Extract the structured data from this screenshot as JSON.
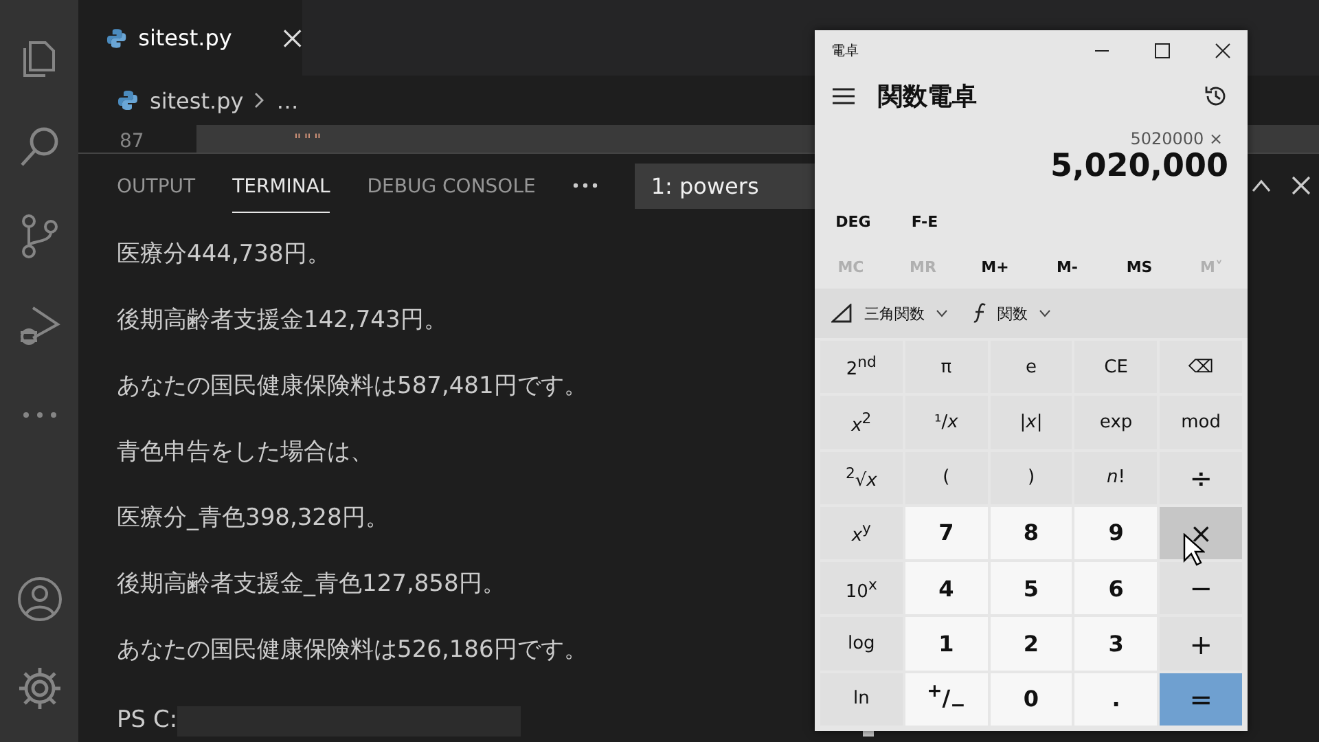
{
  "editor": {
    "tab": {
      "title": "sitest.py",
      "selected": true
    },
    "breadcrumb": {
      "file": "sitest.py",
      "rest": "…"
    },
    "code_line": {
      "number": "87",
      "text": "\"\"\""
    }
  },
  "panel": {
    "tabs": [
      {
        "label": "OUTPUT",
        "selected": false
      },
      {
        "label": "TERMINAL",
        "selected": true
      },
      {
        "label": "DEBUG CONSOLE",
        "selected": false
      }
    ],
    "terminal_selector": "1: powers",
    "terminal_lines": [
      "医療分444,738円。",
      "後期高齢者支援金142,743円。",
      "あなたの国民健康保険料は587,481円です。",
      "青色申告をした場合は、",
      "医療分_青色398,328円。",
      "後期高齢者支援金_青色127,858円。",
      "あなたの国民健康保険料は526,186円です。"
    ],
    "prompt": "PS C:"
  },
  "calculator": {
    "title": "電卓",
    "mode": "関数電卓",
    "expression": "5020000 ×",
    "display": "5,020,000",
    "settings": [
      "DEG",
      "F-E"
    ],
    "memory": [
      {
        "label": "MC",
        "disabled": true
      },
      {
        "label": "MR",
        "disabled": true
      },
      {
        "label": "M+",
        "disabled": false
      },
      {
        "label": "M-",
        "disabled": false
      },
      {
        "label": "MS",
        "disabled": false
      },
      {
        "label": "M˅",
        "disabled": true
      }
    ],
    "trig": "三角関数",
    "functions": "関数",
    "keys": [
      {
        "label": "2$^{nd}$",
        "kind": "function",
        "hovered": false
      },
      {
        "label": "π",
        "kind": "function",
        "hovered": false
      },
      {
        "label": "e",
        "kind": "function",
        "hovered": false
      },
      {
        "label": "CE",
        "kind": "function",
        "hovered": false
      },
      {
        "label": "⌫",
        "kind": "function",
        "hovered": false
      },
      {
        "label": "*x*$^{2}$",
        "kind": "function",
        "hovered": false
      },
      {
        "label": "¹/*x*",
        "kind": "function",
        "hovered": false
      },
      {
        "label": "|*x*|",
        "kind": "function",
        "hovered": false
      },
      {
        "label": "exp",
        "kind": "function",
        "hovered": false
      },
      {
        "label": "mod",
        "kind": "function",
        "hovered": false
      },
      {
        "label": "$^{2}$√*x*",
        "kind": "function",
        "hovered": false
      },
      {
        "label": "(",
        "kind": "function",
        "hovered": false
      },
      {
        "label": ")",
        "kind": "function",
        "hovered": false
      },
      {
        "label": "*n*!",
        "kind": "function",
        "hovered": false
      },
      {
        "label": "÷",
        "kind": "operator",
        "hovered": false
      },
      {
        "label": "*x*$^{y}$",
        "kind": "function",
        "hovered": false
      },
      {
        "label": "7",
        "kind": "digit",
        "hovered": false
      },
      {
        "label": "8",
        "kind": "digit",
        "hovered": false
      },
      {
        "label": "9",
        "kind": "digit",
        "hovered": false
      },
      {
        "label": "×",
        "kind": "operator",
        "hovered": true
      },
      {
        "label": "10$^{x}$",
        "kind": "function",
        "hovered": false
      },
      {
        "label": "4",
        "kind": "digit",
        "hovered": false
      },
      {
        "label": "5",
        "kind": "digit",
        "hovered": false
      },
      {
        "label": "6",
        "kind": "digit",
        "hovered": false
      },
      {
        "label": "−",
        "kind": "operator",
        "hovered": false
      },
      {
        "label": "log",
        "kind": "function",
        "hovered": false
      },
      {
        "label": "1",
        "kind": "digit",
        "hovered": false
      },
      {
        "label": "2",
        "kind": "digit",
        "hovered": false
      },
      {
        "label": "3",
        "kind": "digit",
        "hovered": false
      },
      {
        "label": "+",
        "kind": "operator",
        "hovered": false
      },
      {
        "label": "ln",
        "kind": "function",
        "hovered": false
      },
      {
        "label": "$^{+}$/$_{−}$",
        "kind": "digit",
        "hovered": false
      },
      {
        "label": "0",
        "kind": "digit",
        "hovered": false
      },
      {
        "label": ".",
        "kind": "digit",
        "hovered": false
      },
      {
        "label": "=",
        "kind": "equals",
        "hovered": false
      }
    ]
  }
}
